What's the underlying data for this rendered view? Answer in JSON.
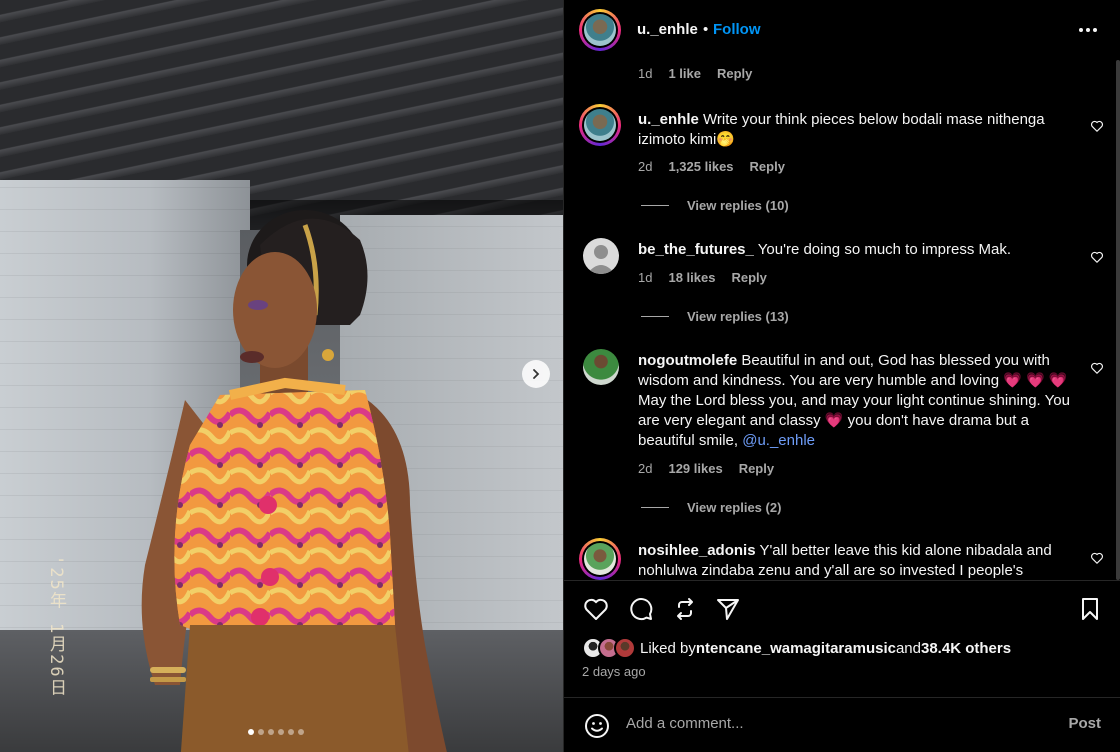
{
  "photo": {
    "date_stamp": "'25年 1月26日",
    "carousel": {
      "total": 6,
      "active": 1
    }
  },
  "post": {
    "author": "u._enhle",
    "separator": "•",
    "follow_label": "Follow"
  },
  "comments": [
    {
      "user": "",
      "text": "",
      "time": "1d",
      "likes": "1 like",
      "reply_label": "Reply",
      "view_replies": ""
    },
    {
      "user": "u._enhle",
      "text": " Write your think pieces below bodali mase nithenga izimoto kimi🤭",
      "time": "2d",
      "likes": "1,325 likes",
      "reply_label": "Reply",
      "view_replies": "View replies (10)"
    },
    {
      "user": "be_the_futures_",
      "text": " You're doing so much to impress Mak.",
      "time": "1d",
      "likes": "18 likes",
      "reply_label": "Reply",
      "view_replies": "View replies (13)"
    },
    {
      "user": "nogoutmolefe",
      "text": " Beautiful in and out, God has blessed you with wisdom and kindness. You are very humble and loving 💗 💗 💗 May the Lord bless you, and may your light continue shining. You are very elegant and classy 💗 you don't have drama but a beautiful smile, ",
      "mention": "@u._enhle",
      "time": "2d",
      "likes": "129 likes",
      "reply_label": "Reply",
      "view_replies": "View replies (2)"
    },
    {
      "user": "nosihlee_adonis",
      "text": " Y'all better leave this kid alone nibadala and nohlulwa zindaba zenu and y'all are so invested I people's",
      "time": "",
      "likes": "",
      "reply_label": "",
      "view_replies": ""
    }
  ],
  "likes_summary": {
    "prefix": "Liked by ",
    "user": "ntencane_wamagitaramusic",
    "middle": " and ",
    "others": "38.4K others",
    "time_ago": "2 days ago"
  },
  "composer": {
    "placeholder": "Add a comment...",
    "post_label": "Post"
  },
  "colors": {
    "accent": "#0095f6",
    "mention": "#6f9df8",
    "heart_emoji": "#ff3b6b",
    "muted": "#a8a8a8"
  }
}
